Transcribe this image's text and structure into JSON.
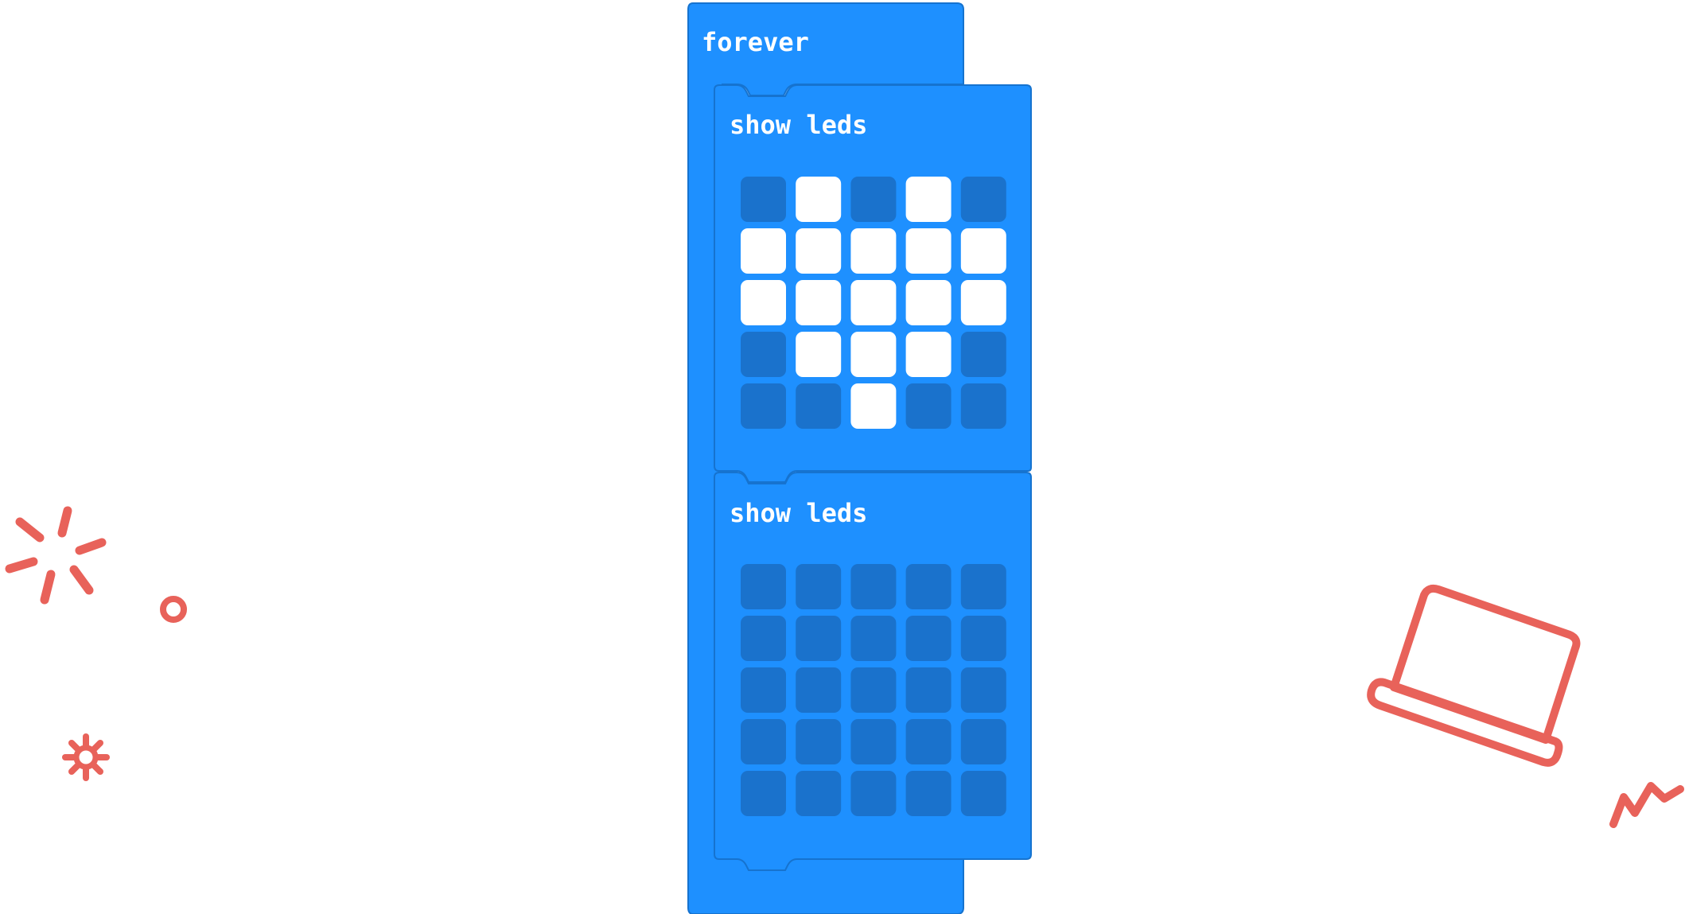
{
  "colors": {
    "background": "#ffffff",
    "block": "#1e90ff",
    "block_outline": "#1673cf",
    "led_off": "#1a72cc",
    "led_on": "#ffffff",
    "doodle": "#e8625a"
  },
  "forever_block": {
    "label": "forever",
    "children": [
      {
        "label": "show leds",
        "leds": [
          [
            0,
            1,
            0,
            1,
            0
          ],
          [
            1,
            1,
            1,
            1,
            1
          ],
          [
            1,
            1,
            1,
            1,
            1
          ],
          [
            0,
            1,
            1,
            1,
            0
          ],
          [
            0,
            0,
            1,
            0,
            0
          ]
        ]
      },
      {
        "label": "show leds",
        "leds": [
          [
            0,
            0,
            0,
            0,
            0
          ],
          [
            0,
            0,
            0,
            0,
            0
          ],
          [
            0,
            0,
            0,
            0,
            0
          ],
          [
            0,
            0,
            0,
            0,
            0
          ],
          [
            0,
            0,
            0,
            0,
            0
          ]
        ]
      }
    ]
  },
  "decorations": [
    "sparkle-burst-icon",
    "small-circle-icon",
    "gear-icon",
    "laptop-icon",
    "zigzag-icon"
  ]
}
